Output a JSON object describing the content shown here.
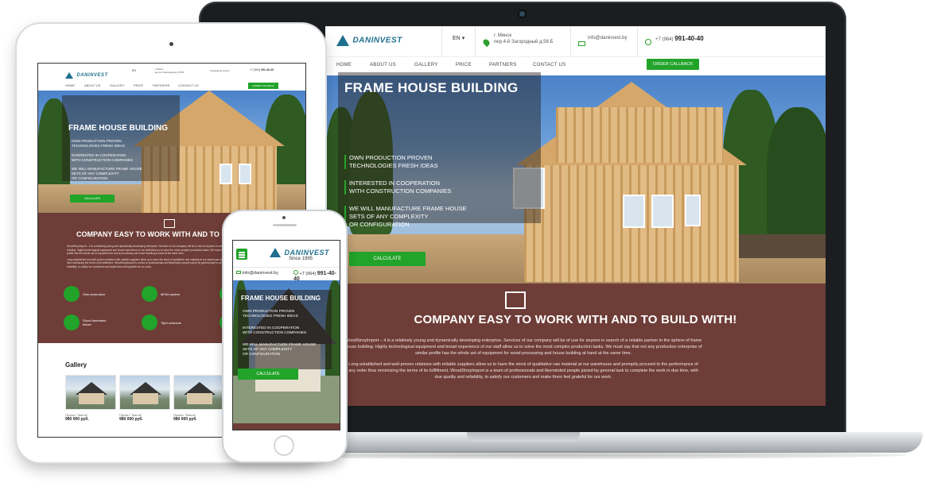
{
  "site": {
    "logo": "DANINVEST",
    "since": "Since 1995",
    "lang": "EN",
    "address_line1": "г. Минск",
    "address_line2": "пер.4-й Загородный д.58 Б",
    "email": "info@daninvest.by",
    "phone_prefix": "+7 (964)",
    "phone_number": "991-40-40",
    "callback": "ORDER CALLBACK"
  },
  "nav": [
    "HOME",
    "ABOUT US",
    "GALLERY",
    "PRICE",
    "PARTNERS",
    "CONTACT US"
  ],
  "hero": {
    "title": "FRAME HOUSE BUILDING",
    "features": [
      [
        "OWN PRODUCTION PROVEN",
        "TECHNOLOGIES FRESH IDEAS"
      ],
      [
        "INTERESTED IN COOPERATION",
        "WITH CONSTRUCTION COMPANIES"
      ],
      [
        "WE WILL MANUFACTURE  FRAME HOUSE",
        "SETS OF ANY COMPLEXITY",
        "OR CONFIGURATION"
      ]
    ],
    "cta": "CALCULATE"
  },
  "about": {
    "title": "COMPANY EASY TO WORK WITH AND TO BUILD WITH!",
    "tablet_title": "COMPANY EASY TO WORK WITH AND TO B",
    "p1": "WoodStroyImport – it is a relatively young and dynamically developing enterprise. Services of our company will be of use for anyone in search of a reliable partner in the sphere of frame house building. Highly technological equipment and broad experience of our staff allow us to solve the most complex production tasks. We must say that not any production enterprise of similar profile has the whole set of equipment for wood processing and house building at hand at the same time.",
    "p2": "Long-established and well-proven relations with reliable suppliers allow us to have the stock of qualitative raw material at our warehouse and promptly proceed to the performance of any order thus minimizing the terms of its fulfillment. WoodStroyImport is a team of professionals and likeminded people joined by general task to complete the work in due time, with due quality and reliability, to satisfy our customers and make them feel grateful for our work."
  },
  "features": [
    {
      "label": "Own production",
      "icon": "factory-icon"
    },
    {
      "label": "MiTek system",
      "icon": "system-icon"
    },
    {
      "label": "Glued laminated timber",
      "icon": "timber-icon"
    },
    {
      "label": "Tight schedule",
      "icon": "clock-icon"
    }
  ],
  "gallery": {
    "title": "Gallery",
    "items": [
      {
        "name": "Проект \"Мачта\"",
        "price": "980 000 руб."
      },
      {
        "name": "Проект \"Мачта\"",
        "price": "980 000 руб."
      },
      {
        "name": "Проект \"Мачта\"",
        "price": "980 000 руб."
      }
    ]
  },
  "colors": {
    "accent": "#22a32a",
    "brand": "#1e6f8e",
    "about_bg": "#6e3d37"
  }
}
